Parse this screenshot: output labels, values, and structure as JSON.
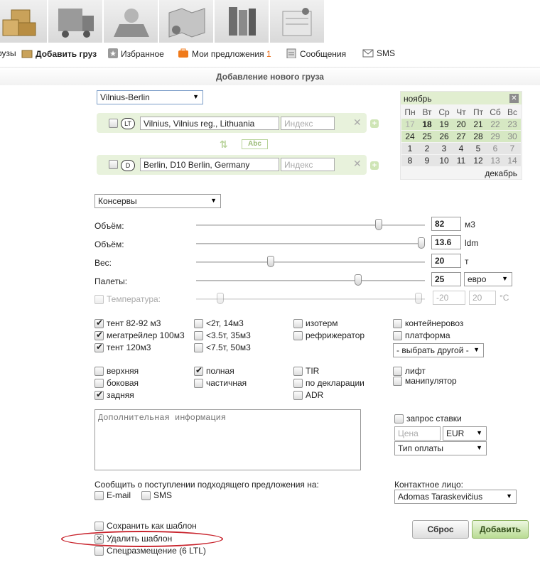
{
  "menu": {
    "cut_item": "рузы",
    "add_cargo": "Добавить груз",
    "favorites": "Избранное",
    "my_offers": "Мои предложения",
    "my_offers_count": "1",
    "messages": "Сообщения",
    "sms": "SMS"
  },
  "page_title": "Добавление нового груза",
  "route": {
    "template_select": "Vilnius-Berlin",
    "from": {
      "country_code": "LT",
      "address": "Vilnius, Vilnius reg.,  Lithuania",
      "zip_placeholder": "Индекс"
    },
    "to": {
      "country_code": "D",
      "address": "Berlin, D10 Berlin,  Germany",
      "zip_placeholder": "Индекс"
    },
    "abc_label": "Abc"
  },
  "calendar": {
    "month": "ноябрь",
    "next_month": "декабрь",
    "weekdays": [
      "Пн",
      "Вт",
      "Ср",
      "Чт",
      "Пт",
      "Сб",
      "Вс"
    ],
    "weeks": [
      [
        "17",
        "18",
        "19",
        "20",
        "21",
        "22",
        "23"
      ],
      [
        "24",
        "25",
        "26",
        "27",
        "28",
        "29",
        "30"
      ],
      [
        "1",
        "2",
        "3",
        "4",
        "5",
        "6",
        "7"
      ],
      [
        "8",
        "9",
        "10",
        "11",
        "12",
        "13",
        "14"
      ]
    ]
  },
  "cargo_type": "Консервы",
  "params": {
    "volume_m3": {
      "label": "Объём:",
      "value": "82",
      "unit": "м3",
      "fraction": 0.8
    },
    "volume_ldm": {
      "label": "Объём:",
      "value": "13.6",
      "unit": "ldm",
      "fraction": 1.0
    },
    "weight": {
      "label": "Вес:",
      "value": "20",
      "unit": "т",
      "fraction": 0.33
    },
    "pallets": {
      "label": "Палеты:",
      "value": "25",
      "unit_select": "евро",
      "fraction": 0.71
    },
    "temperature": {
      "label": "Температура:",
      "min": "-20",
      "max": "20",
      "unit": "°C"
    }
  },
  "vehicles": {
    "col1": [
      "тент 82-92 м3",
      "мегатрейлер 100м3",
      "тент 120м3"
    ],
    "col2": [
      "<2т, 14м3",
      "<3.5т, 35м3",
      "<7.5т, 50м3"
    ],
    "col3": [
      "изотерм",
      "рефрижератор"
    ],
    "col4": [
      "контейнеровоз",
      "платформа"
    ],
    "other_select": "- выбрать другой -"
  },
  "loading": {
    "col1": [
      "верхняя",
      "боковая",
      "задняя"
    ],
    "col2": [
      "полная",
      "частичная"
    ],
    "col3": [
      "TIR",
      "по декларации",
      "ADR"
    ],
    "col4": [
      "лифт",
      "манипулятор"
    ]
  },
  "additional_info_placeholder": "Дополнительная информация",
  "pricing": {
    "rate_request": "запрос ставки",
    "price_placeholder": "Цена",
    "currency": "EUR",
    "payment_type": "Тип оплаты"
  },
  "notify": {
    "label": "Сообщить о поступлении подходящего предложения на:",
    "email": "E-mail",
    "sms": "SMS"
  },
  "contact": {
    "label": "Контактное лицо:",
    "person": "Adomas Taraskevičius"
  },
  "template_options": {
    "save": "Сохранить как шаблон",
    "delete": "Удалить шаблон",
    "special": "Спецразмещение (6 LTL)"
  },
  "buttons": {
    "reset": "Сброс",
    "add": "Добавить"
  },
  "colors": {
    "accent_green": "#b9dc93",
    "highlight_red": "#c8232c",
    "count_orange": "#e8650e"
  }
}
